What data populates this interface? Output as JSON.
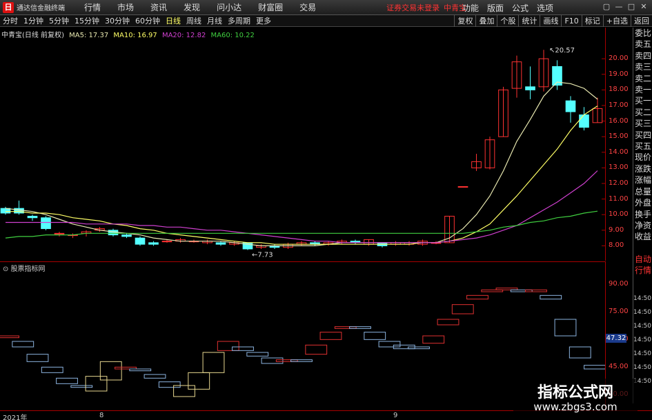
{
  "app": {
    "title": "通达信金融终端",
    "logo": "日",
    "menus": [
      "行情",
      "市场",
      "资讯",
      "发现",
      "问小达",
      "财富圈",
      "交易"
    ],
    "login_status": "证券交易未登录",
    "stock_name": "中青宝",
    "right_menus": [
      "功能",
      "版面",
      "公式",
      "选项"
    ],
    "window_controls": [
      "▢",
      "—",
      "□",
      "✕"
    ]
  },
  "periodbar": {
    "periods": [
      "分时",
      "1分钟",
      "5分钟",
      "15分钟",
      "30分钟",
      "60分钟",
      "日线",
      "周线",
      "月线",
      "多周期",
      "更多"
    ],
    "active": "日线",
    "tools": [
      "复权",
      "叠加",
      "个股",
      "统计",
      "画线",
      "F10",
      "标记",
      "+自选",
      "返回"
    ]
  },
  "chart_header": {
    "stock": "中青宝(日线 前复权)",
    "ma": [
      {
        "label": "MA5: 17.37",
        "color": "#e8e8b0"
      },
      {
        "label": "MA10: 16.97",
        "color": "#ffff66"
      },
      {
        "label": "MA20: 12.82",
        "color": "#d040d0"
      },
      {
        "label": "MA60: 10.22",
        "color": "#40d040"
      }
    ]
  },
  "side_panel": [
    "委比",
    "卖五",
    "卖四",
    "卖三",
    "卖二",
    "卖一",
    "买一",
    "买二",
    "买三",
    "买四",
    "买五",
    "现价",
    "涨跌",
    "涨幅",
    "总量",
    "外盘",
    "换手",
    "净资",
    "收益",
    "自动",
    "行情"
  ],
  "chart_data": [
    {
      "type": "candlestick",
      "title": "中青宝(日线 前复权)",
      "price_ticks": [
        "20.00",
        "19.00",
        "18.00",
        "17.00",
        "16.00",
        "15.00",
        "14.00",
        "13.00",
        "12.00",
        "11.00",
        "10.00",
        "9.00",
        "8.00"
      ],
      "ylim": [
        7.4,
        21.2
      ],
      "annotations": [
        {
          "text": "20.57",
          "at_price": 20.57
        },
        {
          "text": "7.73",
          "at_price": 7.73
        }
      ],
      "candles": [
        {
          "o": 10.4,
          "c": 10.1,
          "h": 10.5,
          "l": 10.0
        },
        {
          "o": 10.4,
          "c": 10.1,
          "h": 10.9,
          "l": 10.0
        },
        {
          "o": 9.9,
          "c": 9.8,
          "h": 10.0,
          "l": 9.6
        },
        {
          "o": 9.8,
          "c": 9.1,
          "h": 9.9,
          "l": 9.0
        },
        {
          "o": 8.8,
          "c": 8.8,
          "h": 8.9,
          "l": 8.6
        },
        {
          "o": 8.7,
          "c": 8.7,
          "h": 8.8,
          "l": 8.5
        },
        {
          "o": 8.8,
          "c": 8.9,
          "h": 9.0,
          "l": 8.6
        },
        {
          "o": 9.0,
          "c": 9.1,
          "h": 9.2,
          "l": 8.9
        },
        {
          "o": 9.0,
          "c": 8.7,
          "h": 9.1,
          "l": 8.6
        },
        {
          "o": 8.7,
          "c": 8.6,
          "h": 8.8,
          "l": 8.5
        },
        {
          "o": 8.5,
          "c": 8.1,
          "h": 8.6,
          "l": 8.0
        },
        {
          "o": 8.2,
          "c": 8.1,
          "h": 8.3,
          "l": 8.0
        },
        {
          "o": 8.3,
          "c": 8.3,
          "h": 8.4,
          "l": 8.2
        },
        {
          "o": 8.3,
          "c": 8.4,
          "h": 8.5,
          "l": 8.2
        },
        {
          "o": 8.3,
          "c": 8.3,
          "h": 8.4,
          "l": 8.2
        },
        {
          "o": 8.2,
          "c": 8.3,
          "h": 8.4,
          "l": 8.1
        },
        {
          "o": 8.2,
          "c": 8.1,
          "h": 8.3,
          "l": 8.0
        },
        {
          "o": 8.1,
          "c": 8.2,
          "h": 8.3,
          "l": 8.0
        },
        {
          "o": 8.2,
          "c": 7.8,
          "h": 8.2,
          "l": 7.73
        },
        {
          "o": 7.9,
          "c": 8.0,
          "h": 8.1,
          "l": 7.8
        },
        {
          "o": 8.0,
          "c": 7.9,
          "h": 8.1,
          "l": 7.8
        },
        {
          "o": 7.9,
          "c": 8.1,
          "h": 8.2,
          "l": 7.8
        },
        {
          "o": 8.1,
          "c": 8.2,
          "h": 8.3,
          "l": 8.0
        },
        {
          "o": 8.2,
          "c": 8.1,
          "h": 8.3,
          "l": 8.0
        },
        {
          "o": 8.1,
          "c": 8.2,
          "h": 8.3,
          "l": 8.0
        },
        {
          "o": 8.2,
          "c": 8.3,
          "h": 8.4,
          "l": 8.1
        },
        {
          "o": 8.3,
          "c": 8.2,
          "h": 8.4,
          "l": 8.1
        },
        {
          "o": 8.1,
          "c": 8.4,
          "h": 8.4,
          "l": 8.0
        },
        {
          "o": 8.2,
          "c": 8.0,
          "h": 8.2,
          "l": 7.9
        },
        {
          "o": 8.1,
          "c": 8.2,
          "h": 8.3,
          "l": 8.0
        },
        {
          "o": 8.1,
          "c": 8.2,
          "h": 8.3,
          "l": 8.0
        },
        {
          "o": 8.1,
          "c": 8.3,
          "h": 8.4,
          "l": 8.0
        },
        {
          "o": 8.2,
          "c": 8.2,
          "h": 8.3,
          "l": 8.1
        },
        {
          "o": 8.2,
          "c": 9.9,
          "h": 9.9,
          "l": 8.2
        },
        {
          "o": 11.8,
          "c": 11.8,
          "h": 11.8,
          "l": 11.8
        },
        {
          "o": 13.0,
          "c": 13.4,
          "h": 13.9,
          "l": 12.8
        },
        {
          "o": 13.0,
          "c": 14.8,
          "h": 15.0,
          "l": 12.9
        },
        {
          "o": 15.0,
          "c": 18.0,
          "h": 18.2,
          "l": 15.0
        },
        {
          "o": 18.1,
          "c": 19.8,
          "h": 20.2,
          "l": 17.5
        },
        {
          "o": 18.2,
          "c": 18.0,
          "h": 19.5,
          "l": 17.4
        },
        {
          "o": 18.2,
          "c": 20.0,
          "h": 20.57,
          "l": 17.9
        },
        {
          "o": 19.5,
          "c": 18.3,
          "h": 19.9,
          "l": 18.0
        },
        {
          "o": 17.3,
          "c": 16.6,
          "h": 17.6,
          "l": 15.9
        },
        {
          "o": 16.4,
          "c": 15.6,
          "h": 16.9,
          "l": 15.4
        },
        {
          "o": 15.9,
          "c": 16.8,
          "h": 17.5,
          "l": 15.9
        }
      ],
      "ma_lines": [
        {
          "name": "MA5",
          "color": "#e8e8b0",
          "values": [
            10.4,
            10.3,
            10.2,
            10.0,
            9.7,
            9.4,
            9.2,
            9.0,
            8.9,
            8.8,
            8.7,
            8.5,
            8.4,
            8.3,
            8.3,
            8.3,
            8.3,
            8.2,
            8.1,
            8.0,
            8.0,
            8.0,
            8.0,
            8.0,
            8.1,
            8.2,
            8.2,
            8.2,
            8.2,
            8.2,
            8.2,
            8.2,
            8.2,
            8.5,
            9.1,
            10.0,
            11.2,
            12.8,
            14.7,
            16.1,
            17.6,
            18.5,
            18.4,
            18.1,
            17.4
          ]
        },
        {
          "name": "MA10",
          "color": "#ffff66",
          "values": [
            10.2,
            10.2,
            10.1,
            10.1,
            10.0,
            9.8,
            9.7,
            9.6,
            9.4,
            9.3,
            9.1,
            9.0,
            8.8,
            8.7,
            8.6,
            8.5,
            8.4,
            8.3,
            8.2,
            8.2,
            8.1,
            8.1,
            8.1,
            8.1,
            8.1,
            8.1,
            8.1,
            8.1,
            8.1,
            8.1,
            8.1,
            8.2,
            8.2,
            8.3,
            8.5,
            8.9,
            9.4,
            10.3,
            11.2,
            12.2,
            13.2,
            14.2,
            15.4,
            16.4,
            16.97
          ]
        },
        {
          "name": "MA20",
          "color": "#d040d0",
          "values": [
            9.5,
            9.5,
            9.5,
            9.5,
            9.5,
            9.5,
            9.4,
            9.4,
            9.4,
            9.4,
            9.3,
            9.3,
            9.2,
            9.2,
            9.1,
            9.0,
            9.0,
            8.9,
            8.8,
            8.7,
            8.6,
            8.5,
            8.4,
            8.3,
            8.3,
            8.2,
            8.2,
            8.2,
            8.2,
            8.2,
            8.2,
            8.2,
            8.2,
            8.3,
            8.4,
            8.5,
            8.7,
            9.0,
            9.3,
            9.8,
            10.3,
            10.8,
            11.4,
            12.0,
            12.82
          ]
        },
        {
          "name": "MA60",
          "color": "#40d040",
          "values": [
            8.5,
            8.6,
            8.6,
            8.7,
            8.7,
            8.7,
            8.8,
            8.8,
            8.8,
            8.8,
            8.8,
            8.8,
            8.8,
            8.8,
            8.8,
            8.8,
            8.8,
            8.8,
            8.8,
            8.8,
            8.8,
            8.8,
            8.8,
            8.8,
            8.8,
            8.8,
            8.8,
            8.8,
            8.8,
            8.8,
            8.8,
            8.8,
            8.8,
            8.8,
            8.8,
            8.9,
            9.0,
            9.2,
            9.3,
            9.5,
            9.6,
            9.8,
            9.9,
            10.1,
            10.22
          ]
        }
      ]
    },
    {
      "type": "box-indicator",
      "title": "股票指标网",
      "ticks": [
        "90.00",
        "75.00",
        "60.00",
        "45.00",
        "30.00"
      ],
      "ylim": [
        26,
        95
      ],
      "current_value": "47.32",
      "side_labels": [
        "14:50",
        "14:50",
        "14:50",
        "14:50",
        "14:50",
        "14:50",
        "14:50"
      ],
      "boxes": [
        {
          "top": 62,
          "bottom": 61,
          "color": "red"
        },
        {
          "top": 59,
          "bottom": 56,
          "color": "blue"
        },
        {
          "top": 52,
          "bottom": 48,
          "color": "blue"
        },
        {
          "top": 45,
          "bottom": 42,
          "color": "blue"
        },
        {
          "top": 39,
          "bottom": 36,
          "color": "blue"
        },
        {
          "top": 35,
          "bottom": 34,
          "color": "blue"
        },
        {
          "top": 40,
          "bottom": 32,
          "color": "yellow"
        },
        {
          "top": 48,
          "bottom": 38,
          "color": "yellow"
        },
        {
          "top": 45,
          "bottom": 44,
          "color": "red"
        },
        {
          "top": 44,
          "bottom": 43,
          "color": "blue"
        },
        {
          "top": 41,
          "bottom": 39,
          "color": "blue"
        },
        {
          "top": 37,
          "bottom": 34,
          "color": "blue"
        },
        {
          "top": 35,
          "bottom": 29,
          "color": "yellow"
        },
        {
          "top": 42,
          "bottom": 33,
          "color": "yellow"
        },
        {
          "top": 53,
          "bottom": 42,
          "color": "yellow"
        },
        {
          "top": 59,
          "bottom": 54,
          "color": "red"
        },
        {
          "top": 56,
          "bottom": 54,
          "color": "blue"
        },
        {
          "top": 53,
          "bottom": 51,
          "color": "blue"
        },
        {
          "top": 50,
          "bottom": 47,
          "color": "blue"
        },
        {
          "top": 49,
          "bottom": 48,
          "color": "red"
        },
        {
          "top": 49,
          "bottom": 48,
          "color": "blue"
        },
        {
          "top": 57,
          "bottom": 52,
          "color": "red"
        },
        {
          "top": 64,
          "bottom": 60,
          "color": "red"
        },
        {
          "top": 67,
          "bottom": 66,
          "color": "red"
        },
        {
          "top": 67,
          "bottom": 66,
          "color": "blue"
        },
        {
          "top": 64,
          "bottom": 60,
          "color": "blue"
        },
        {
          "top": 59,
          "bottom": 56,
          "color": "blue"
        },
        {
          "top": 57,
          "bottom": 55,
          "color": "blue"
        },
        {
          "top": 56,
          "bottom": 55,
          "color": "blue"
        },
        {
          "top": 62,
          "bottom": 58,
          "color": "red"
        },
        {
          "top": 71,
          "bottom": 68,
          "color": "red"
        },
        {
          "top": 79,
          "bottom": 74,
          "color": "red"
        },
        {
          "top": 84,
          "bottom": 82,
          "color": "red"
        },
        {
          "top": 87,
          "bottom": 86,
          "color": "red"
        },
        {
          "top": 88,
          "bottom": 87,
          "color": "red"
        },
        {
          "top": 87,
          "bottom": 86,
          "color": "blue"
        },
        {
          "top": 87,
          "bottom": 86,
          "color": "red"
        },
        {
          "top": 84,
          "bottom": 82,
          "color": "blue"
        },
        {
          "top": 71,
          "bottom": 62,
          "color": "blue"
        },
        {
          "top": 56,
          "bottom": 50,
          "color": "blue"
        },
        {
          "top": 46,
          "bottom": 44,
          "color": "blue"
        }
      ]
    }
  ],
  "date_labels": [
    "2021年",
    "8",
    "9"
  ],
  "watermark": {
    "title": "指标公式网",
    "url": "www.zbgs3.com"
  }
}
